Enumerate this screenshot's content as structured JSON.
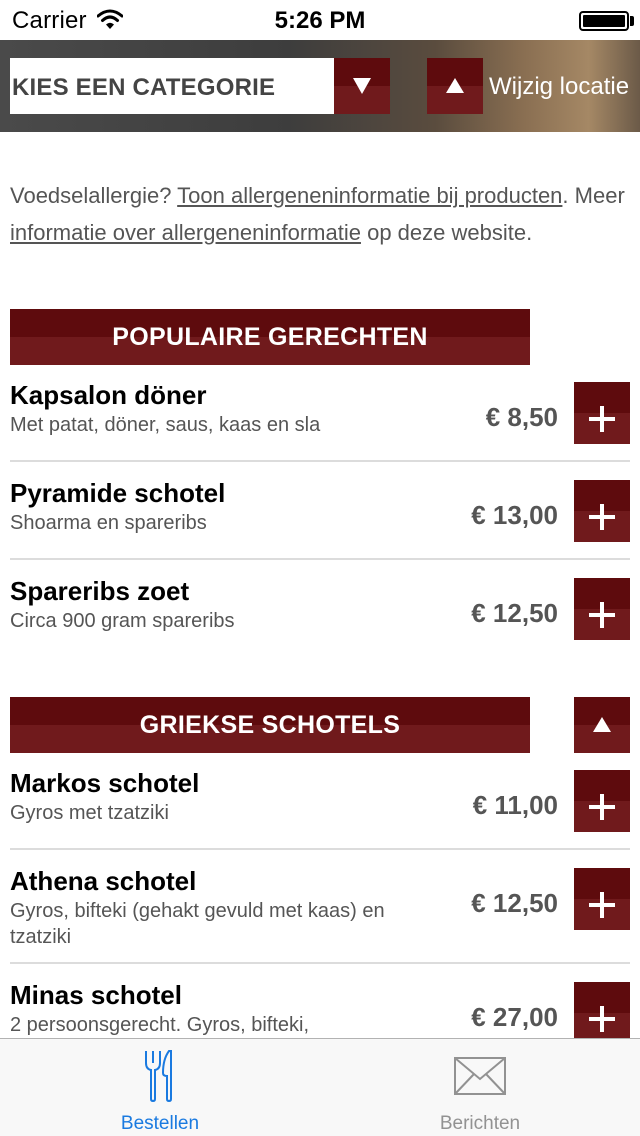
{
  "status_bar": {
    "carrier": "Carrier",
    "time": "5:26 PM"
  },
  "header": {
    "category_placeholder": "KIES EEN CATEGORIE",
    "change_location_label": "Wijzig locatie"
  },
  "info": {
    "prefix": "Voedselallergie? ",
    "link1": "Toon allergeneninformatie bij producten",
    "middle": ". Meer ",
    "link2": "informatie over allergeneninformatie",
    "suffix": " op deze website."
  },
  "sections": [
    {
      "title": "POPULAIRE GERECHTEN",
      "items": [
        {
          "name": "Kapsalon döner",
          "description": "Met patat, döner, saus, kaas en sla",
          "price": "€ 8,50"
        },
        {
          "name": "Pyramide schotel",
          "description": "Shoarma en spareribs",
          "price": "€ 13,00"
        },
        {
          "name": "Spareribs zoet",
          "description": "Circa 900 gram spareribs",
          "price": "€ 12,50"
        }
      ]
    },
    {
      "title": "GRIEKSE SCHOTELS",
      "items": [
        {
          "name": "Markos schotel",
          "description": "Gyros met tzatziki",
          "price": "€ 11,00"
        },
        {
          "name": "Athena schotel",
          "description": "Gyros, bifteki (gehakt gevuld met kaas) en tzatziki",
          "price": "€ 12,50"
        },
        {
          "name": "Minas schotel",
          "description": "2 persoonsgerecht. Gyros, bifteki,",
          "price": "€ 27,00"
        }
      ]
    }
  ],
  "tabbar": {
    "tabs": [
      {
        "label": "Bestellen",
        "icon": "fork-knife-icon",
        "active": true
      },
      {
        "label": "Berichten",
        "icon": "envelope-icon",
        "active": false
      }
    ]
  },
  "colors": {
    "brand_dark": "#5e0b0d",
    "brand_light": "#701a1c",
    "tab_active": "#1a7ae0",
    "tab_inactive": "#929292"
  }
}
